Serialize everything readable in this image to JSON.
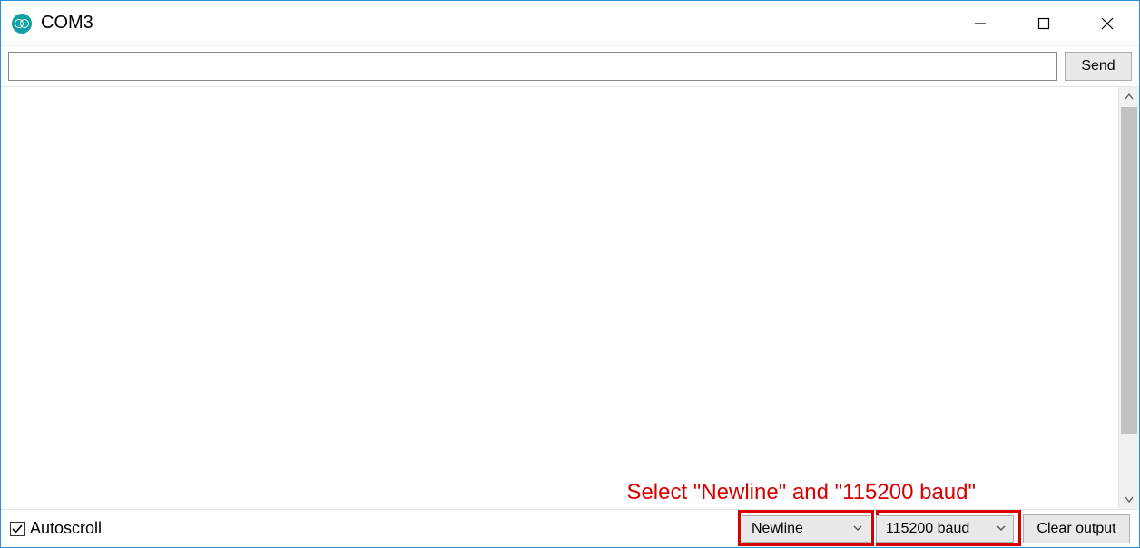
{
  "window": {
    "title": "COM3"
  },
  "send": {
    "input_value": "",
    "input_placeholder": "",
    "button_label": "Send"
  },
  "bottom": {
    "autoscroll_label": "Autoscroll",
    "autoscroll_checked": true,
    "line_ending_selected": "Newline",
    "baud_selected": "115200 baud",
    "clear_label": "Clear output"
  },
  "annotation": {
    "text": "Select \"Newline\" and \"115200 baud\""
  }
}
